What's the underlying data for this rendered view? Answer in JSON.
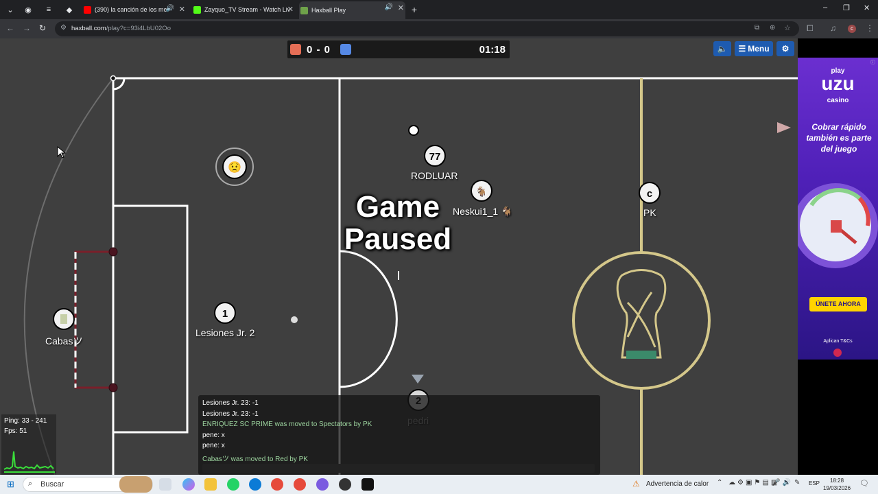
{
  "browser": {
    "tabs": [
      {
        "title": "(390) la canción de los mer",
        "active": false,
        "audio": true,
        "favicon_color": "#ff0000"
      },
      {
        "title": "Zayquo_TV Stream - Watch Liv",
        "active": false,
        "audio": true,
        "favicon_color": "#53fc18"
      },
      {
        "title": "Haxball Play",
        "active": true,
        "audio": true,
        "favicon_color": "#6fa24a"
      }
    ],
    "new_tab": "+",
    "url_host": "haxball.com",
    "url_path": "/play?c=93i4LbU02Oo",
    "window_controls": [
      "–",
      "❐",
      "✕"
    ]
  },
  "game": {
    "score_red": 0,
    "score_blue": 0,
    "score_text": "0 - 0",
    "timer": "01:18",
    "red_color": "#e56e56",
    "blue_color": "#5689e5",
    "paused_text": "Game\nPaused",
    "menu_label": "Menu",
    "players": [
      {
        "name": "RODLUAR",
        "number": "77",
        "team": "spectator-white"
      },
      {
        "name": "Neskui1_1 🐐",
        "number": "",
        "team": "white"
      },
      {
        "name": "PK",
        "number": "c",
        "team": "white"
      },
      {
        "name": "Lesiones Jr. 2",
        "number": "1",
        "team": "white"
      },
      {
        "name": "Cabasツ",
        "number": "",
        "team": "white"
      },
      {
        "name": "pedri",
        "number": "2",
        "team": "white"
      }
    ],
    "emoji_player": "😟"
  },
  "chat": {
    "lines": [
      {
        "text": "Lesiones Jr. 23: -1",
        "system": false
      },
      {
        "text": "Lesiones Jr. 23: -1",
        "system": false
      },
      {
        "text": "ENRIQUEZ SC PRIME was moved to Spectators by PK",
        "system": true
      },
      {
        "text": "pene: x",
        "system": false
      },
      {
        "text": "pene: x",
        "system": false
      },
      {
        "text": "Cabasツ was moved to Red by PK",
        "system": true
      }
    ]
  },
  "stats": {
    "ping": "Ping: 33 - 241",
    "fps": "Fps: 51"
  },
  "ad": {
    "brand_top": "play",
    "brand_main": "uzu",
    "brand_sub": "casino",
    "headline": "Cobrar rápido también es parte del juego",
    "cta": "ÚNETE AHORA",
    "terms": "Aplican T&Cs"
  },
  "taskbar": {
    "search_placeholder": "Buscar",
    "weather_text": "Advertencia de calor",
    "lang": "ESP",
    "time": "18:28",
    "date": "19/03/2026"
  }
}
